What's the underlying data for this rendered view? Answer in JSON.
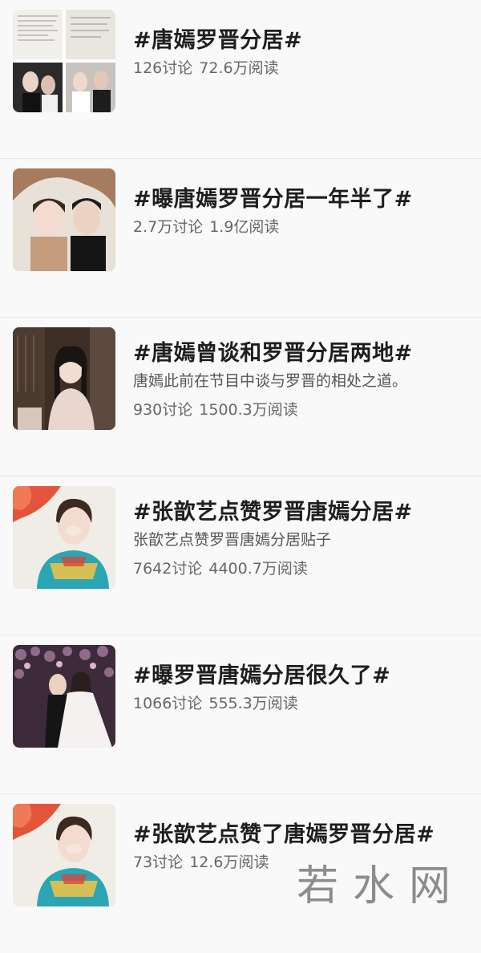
{
  "topics": [
    {
      "title": "#唐嫣罗晋分居#",
      "desc": "",
      "discussions": "126讨论",
      "reads": "72.6万阅读",
      "thumb": "collage-icon"
    },
    {
      "title": "#曝唐嫣罗晋分居一年半了#",
      "desc": "",
      "discussions": "2.7万讨论",
      "reads": "1.9亿阅读",
      "thumb": "couple-photo-icon"
    },
    {
      "title": "#唐嫣曾谈和罗晋分居两地#",
      "desc": "唐嫣此前在节目中谈与罗晋的相处之道。",
      "discussions": "930讨论",
      "reads": "1500.3万阅读",
      "thumb": "interview-photo-icon"
    },
    {
      "title": "#张歆艺点赞罗晋唐嫣分居#",
      "desc": "张歆艺点赞罗晋唐嫣分居贴子",
      "discussions": "7642讨论",
      "reads": "4400.7万阅读",
      "thumb": "portrait-photo-icon"
    },
    {
      "title": "#曝罗晋唐嫣分居很久了#",
      "desc": "",
      "discussions": "1066讨论",
      "reads": "555.3万阅读",
      "thumb": "wedding-photo-icon"
    },
    {
      "title": "#张歆艺点赞了唐嫣罗晋分居#",
      "desc": "",
      "discussions": "73讨论",
      "reads": "12.6万阅读",
      "thumb": "portrait-photo-icon"
    }
  ],
  "watermark": "若水网"
}
